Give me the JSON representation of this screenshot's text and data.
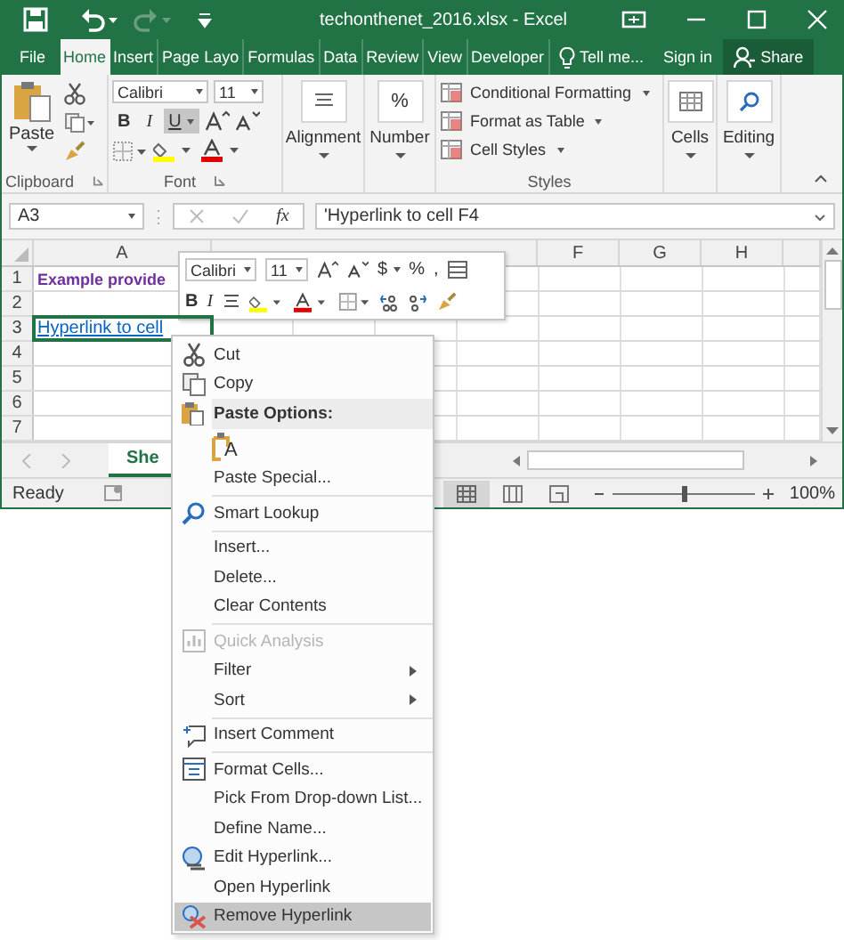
{
  "title_bar": {
    "title": "techonthenet_2016.xlsx - Excel"
  },
  "tabs": [
    {
      "label": "File",
      "selected": false
    },
    {
      "label": "Home",
      "selected": true
    },
    {
      "label": "Insert",
      "selected": false
    },
    {
      "label": "Page Layo",
      "selected": false
    },
    {
      "label": "Formulas",
      "selected": false
    },
    {
      "label": "Data",
      "selected": false
    },
    {
      "label": "Review",
      "selected": false
    },
    {
      "label": "View",
      "selected": false
    },
    {
      "label": "Developer",
      "selected": false
    }
  ],
  "tell_me": "Tell me...",
  "sign_in": "Sign in",
  "share": "Share",
  "ribbon": {
    "clipboard": {
      "paste": "Paste",
      "label": "Clipboard"
    },
    "font": {
      "name": "Calibri",
      "size": "11",
      "bold": "B",
      "italic": "I",
      "underline": "U",
      "underline_selected": true,
      "label": "Font"
    },
    "alignment": "Alignment",
    "number": {
      "symbol": "%",
      "label": "Number"
    },
    "styles": {
      "items": [
        "Conditional Formatting",
        "Format as Table",
        "Cell Styles"
      ],
      "label": "Styles"
    },
    "cells": "Cells",
    "editing": "Editing"
  },
  "formula_bar": {
    "name_box": "A3",
    "function_label": "fx",
    "formula": "'Hyperlink to cell F4"
  },
  "grid": {
    "columns": [
      "A",
      "F",
      "G",
      "H"
    ],
    "rows": [
      {
        "number": "1",
        "text": "Example provide",
        "kind": "heading",
        "selected": false
      },
      {
        "number": "2",
        "selected": false
      },
      {
        "number": "3",
        "text": "Hyperlink to cell",
        "kind": "link",
        "selected": true
      },
      {
        "number": "4",
        "selected": false
      },
      {
        "number": "5",
        "selected": false
      },
      {
        "number": "6",
        "selected": false
      },
      {
        "number": "7",
        "selected": false
      }
    ]
  },
  "sheet_tab": "She",
  "status_bar": {
    "status": "Ready",
    "zoom_slider": {
      "level": 0.5
    },
    "zoom": "100%"
  },
  "mini_toolbar": {
    "font": "Calibri",
    "size": "11",
    "currency": "$",
    "percent": "%",
    "comma": ",",
    "bold": "B",
    "italic": "I"
  },
  "context_menu": [
    {
      "kind": "item",
      "label": "Cut",
      "disabled": false,
      "selected": false
    },
    {
      "kind": "item",
      "label": "Copy",
      "disabled": false,
      "selected": false
    },
    {
      "kind": "header",
      "label": "Paste Options:"
    },
    {
      "kind": "paste_option",
      "label": "A"
    },
    {
      "kind": "item",
      "label": "Paste Special...",
      "disabled": false,
      "selected": false
    },
    {
      "kind": "separator"
    },
    {
      "kind": "item",
      "label": "Smart Lookup",
      "disabled": false,
      "selected": false
    },
    {
      "kind": "separator"
    },
    {
      "kind": "item",
      "label": "Insert...",
      "disabled": false,
      "selected": false
    },
    {
      "kind": "item",
      "label": "Delete...",
      "disabled": false,
      "selected": false
    },
    {
      "kind": "item",
      "label": "Clear Contents",
      "disabled": false,
      "selected": false
    },
    {
      "kind": "separator"
    },
    {
      "kind": "item",
      "label": "Quick Analysis",
      "disabled": true,
      "selected": false
    },
    {
      "kind": "submenu",
      "label": "Filter",
      "disabled": false,
      "selected": false
    },
    {
      "kind": "submenu",
      "label": "Sort",
      "disabled": false,
      "selected": false
    },
    {
      "kind": "separator"
    },
    {
      "kind": "item",
      "label": "Insert Comment",
      "disabled": false,
      "selected": false
    },
    {
      "kind": "separator"
    },
    {
      "kind": "item",
      "label": "Format Cells...",
      "disabled": false,
      "selected": false
    },
    {
      "kind": "item",
      "label": "Pick From Drop-down List...",
      "disabled": false,
      "selected": false
    },
    {
      "kind": "item",
      "label": "Define Name...",
      "disabled": false,
      "selected": false
    },
    {
      "kind": "item",
      "label": "Edit Hyperlink...",
      "disabled": false,
      "selected": false
    },
    {
      "kind": "item",
      "label": "Open Hyperlink",
      "disabled": false,
      "selected": false
    },
    {
      "kind": "item",
      "label": "Remove Hyperlink",
      "disabled": false,
      "selected": true
    }
  ]
}
